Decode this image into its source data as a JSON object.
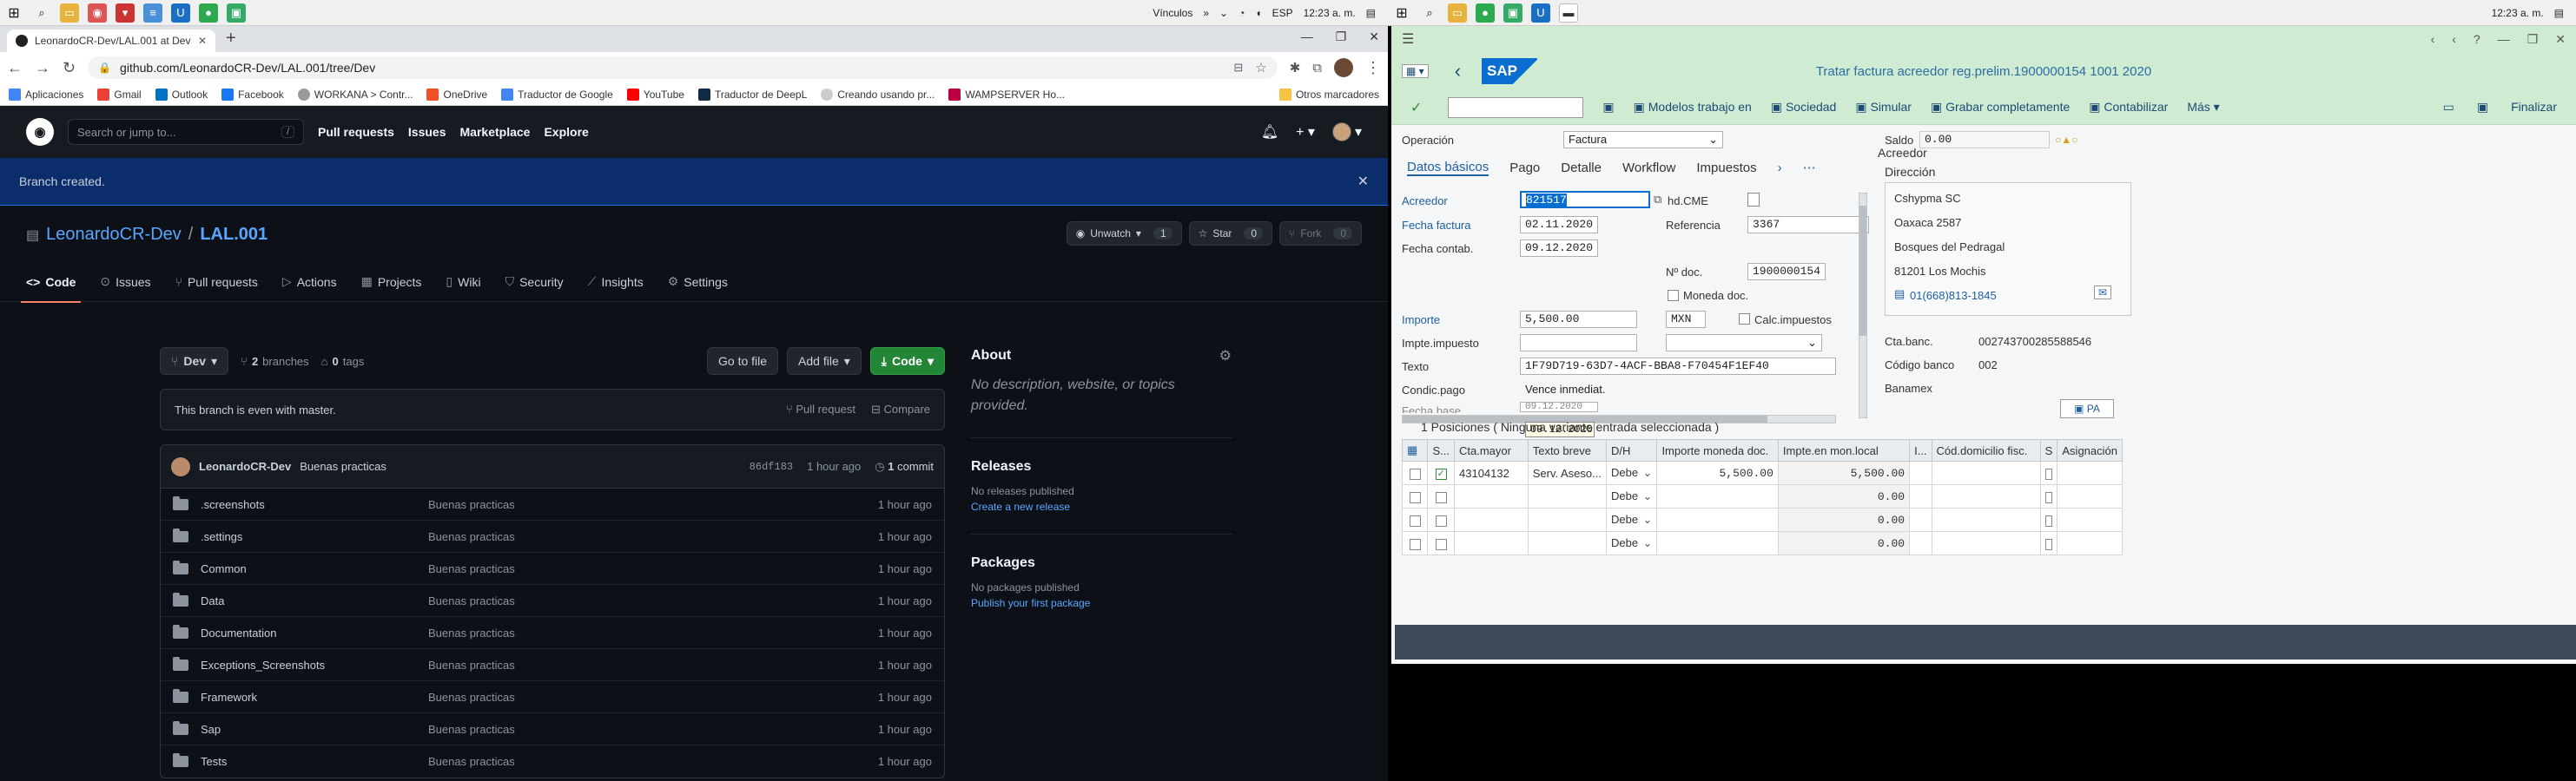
{
  "left_taskbar": {
    "tray_items": [
      "Vínculos",
      "»",
      "ESP",
      "12:23 a. m."
    ]
  },
  "right_taskbar": {
    "clock": "12:23 a. m."
  },
  "chrome": {
    "tab_title": "LeonardoCR-Dev/LAL.001 at Dev",
    "url": "github.com/LeonardoCR-Dev/LAL.001/tree/Dev",
    "bookmarks": [
      "Aplicaciones",
      "Gmail",
      "Outlook",
      "Facebook",
      "WORKANA > Contr...",
      "OneDrive",
      "Traductor de Google",
      "YouTube",
      "Traductor de DeepL",
      "Creando usando pr...",
      "WAMPSERVER Ho..."
    ],
    "bookmarks_more": "Otros marcadores"
  },
  "github": {
    "search_placeholder": "Search or jump to...",
    "search_hint": "/",
    "nav": [
      "Pull requests",
      "Issues",
      "Marketplace",
      "Explore"
    ],
    "flash": "Branch created.",
    "owner": "LeonardoCR-Dev",
    "separator": "/",
    "repo": "LAL.001",
    "unwatch": "Unwatch",
    "unwatch_count": "1",
    "star": "Star",
    "star_count": "0",
    "fork": "Fork",
    "fork_count": "0",
    "tabs": [
      "Code",
      "Issues",
      "Pull requests",
      "Actions",
      "Projects",
      "Wiki",
      "Security",
      "Insights",
      "Settings"
    ],
    "branch": "Dev",
    "branches_count": "2",
    "branches_label": "branches",
    "tags_count": "0",
    "tags_label": "tags",
    "go_to_file": "Go to file",
    "add_file": "Add file",
    "code_button": "Code",
    "even_msg": "This branch is even with master.",
    "pull_request": "Pull request",
    "compare": "Compare",
    "commit_author": "LeonardoCR-Dev",
    "commit_msg": "Buenas practicas",
    "commit_hash": "86df183",
    "commit_time": "1 hour ago",
    "commit_count": "1",
    "commit_label": "commit",
    "files": [
      {
        "name": ".screenshots",
        "msg": "Buenas practicas",
        "time": "1 hour ago"
      },
      {
        "name": ".settings",
        "msg": "Buenas practicas",
        "time": "1 hour ago"
      },
      {
        "name": "Common",
        "msg": "Buenas practicas",
        "time": "1 hour ago"
      },
      {
        "name": "Data",
        "msg": "Buenas practicas",
        "time": "1 hour ago"
      },
      {
        "name": "Documentation",
        "msg": "Buenas practicas",
        "time": "1 hour ago"
      },
      {
        "name": "Exceptions_Screenshots",
        "msg": "Buenas practicas",
        "time": "1 hour ago"
      },
      {
        "name": "Framework",
        "msg": "Buenas practicas",
        "time": "1 hour ago"
      },
      {
        "name": "Sap",
        "msg": "Buenas practicas",
        "time": "1 hour ago"
      },
      {
        "name": "Tests",
        "msg": "Buenas practicas",
        "time": "1 hour ago"
      }
    ],
    "about_title": "About",
    "about_desc": "No description, website, or topics provided.",
    "releases_title": "Releases",
    "releases_none": "No releases published",
    "releases_link": "Create a new release",
    "packages_title": "Packages",
    "packages_none": "No packages published",
    "packages_link": "Publish your first package"
  },
  "sap": {
    "title": "Tratar factura acreedor reg.prelim.1900000154 1001 2020",
    "toolbar": [
      "Modelos trabajo en",
      "Sociedad",
      "Simular",
      "Grabar completamente",
      "Contabilizar",
      "Más"
    ],
    "finalize": "Finalizar",
    "operacion_label": "Operación",
    "operacion_value": "Factura",
    "saldo_label": "Saldo",
    "saldo_value": "0.00",
    "tabs": [
      "Datos básicos",
      "Pago",
      "Detalle",
      "Workflow",
      "Impuestos"
    ],
    "acreedor_label": "Acreedor",
    "acreedor_value": "821517",
    "hd_cme": "hd.CME",
    "fecha_factura_label": "Fecha factura",
    "fecha_factura": "02.11.2020",
    "referencia_label": "Referencia",
    "referencia": "3367",
    "fecha_contab_label": "Fecha contab.",
    "fecha_contab": "09.12.2020",
    "ndoc_label": "Nº doc.",
    "ndoc": "1900000154",
    "moneda_doc": "Moneda doc.",
    "importe_label": "Importe",
    "importe": "5,500.00",
    "moneda": "MXN",
    "calc_imp": "Calc.impuestos",
    "impte_impuesto_label": "Impte.impuesto",
    "texto_label": "Texto",
    "texto": "1F79D719-63D7-4ACF-BBA8-F70454F1EF40",
    "condic_pago_label": "Condic.pago",
    "condic_pago": "Vence inmediat.",
    "fecha_base_label": "Fecha base",
    "fecha_base": "09.12.2020",
    "tooltip_date": "09.12.2020",
    "acreedor_panel_title": "Acreedor",
    "direccion_title": "Dirección",
    "address": [
      "Cshypma SC",
      "Oaxaca 2587",
      "Bosques del Pedragal",
      "81201 Los Mochis"
    ],
    "phone": "01(668)813-1845",
    "cta_banc_label": "Cta.banc.",
    "cta_banc": "002743700285588546",
    "codigo_banco_label": "Código banco",
    "codigo_banco": "002",
    "bank_name": "Banamex",
    "pa_button": "PA",
    "positions_title": "1 Posiciones ( Ninguna variante entrada seleccionada )",
    "grid_headers": [
      "S...",
      "Cta.mayor",
      "Texto breve",
      "D/H",
      "Importe moneda doc.",
      "Impte.en mon.local",
      "I...",
      "Cód.domicilio fisc.",
      "S",
      "Asignación"
    ],
    "grid_rows": [
      {
        "cta": "43104132",
        "texto": "Serv. Aseso...",
        "dh": "Debe",
        "importe": "5,500.00",
        "local": "5,500.00"
      },
      {
        "cta": "",
        "texto": "",
        "dh": "Debe",
        "importe": "",
        "local": "0.00"
      },
      {
        "cta": "",
        "texto": "",
        "dh": "Debe",
        "importe": "",
        "local": "0.00"
      },
      {
        "cta": "",
        "texto": "",
        "dh": "Debe",
        "importe": "",
        "local": "0.00"
      }
    ]
  }
}
